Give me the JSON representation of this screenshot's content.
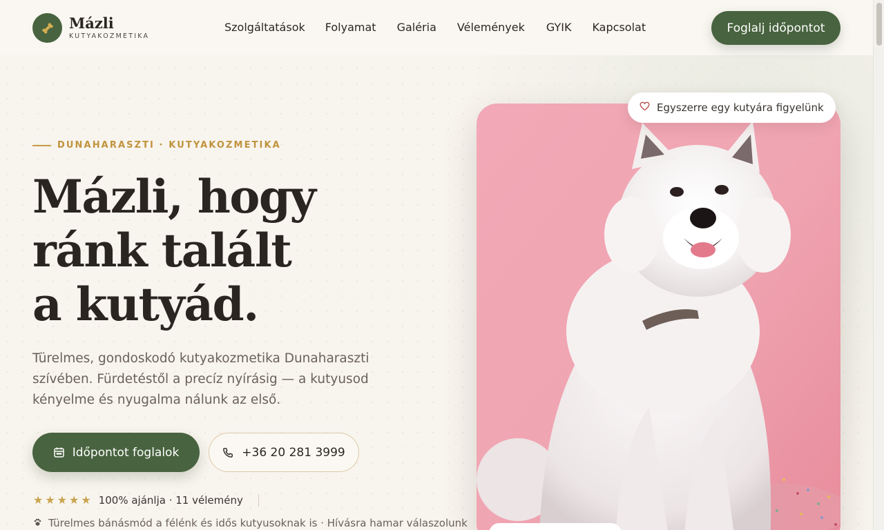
{
  "brand": {
    "name": "Mázli",
    "subtitle": "KUTYAKOZMETIKA",
    "accent_color": "#48633f",
    "gold_color": "#c0933d"
  },
  "nav": {
    "items": [
      "Szolgáltatások",
      "Folyamat",
      "Galéria",
      "Vélemények",
      "GYIK",
      "Kapcsolat"
    ],
    "cta_label": "Foglalj időpontot"
  },
  "hero": {
    "eyebrow": "DUNAHARASZTI · KUTYAKOZMETIKA",
    "headline_lines": [
      "Mázli, hogy",
      "ránk talált",
      "a kutyád."
    ],
    "lead": "Türelmes, gondoskodó kutyakozmetika Dunaharaszti szívében. Fürdetéstől a precíz nyírásig — a kutyusod kényelme és nyugalma nálunk az első.",
    "primary_button": "Időpontot foglalok",
    "phone_button": "+36 20 281 3999",
    "rating_stars": 5,
    "rating_text": "100% ajánlja · 11 vélemény",
    "feature_text": "Türelmes bánásmód a félénk és idős kutyusoknak is · Hívásra hamar válaszolunk",
    "photo_badge": "Egyszerre egy kutyára figyelünk"
  },
  "icons": {
    "logo": "bone-icon",
    "calendar": "calendar-icon",
    "phone": "phone-icon",
    "star": "star-icon",
    "heart": "heart-icon",
    "paw": "paw-icon"
  }
}
